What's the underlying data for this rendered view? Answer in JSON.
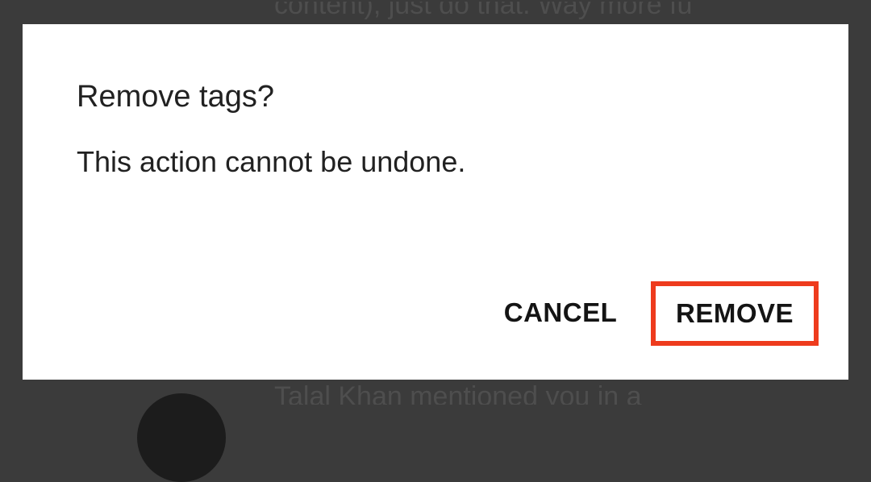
{
  "background": {
    "partial_text_top": "content), just do that. Way more fu",
    "partial_text_bottom": "Talal Khan mentioned you in a"
  },
  "dialog": {
    "title": "Remove tags?",
    "message": "This action cannot be undone.",
    "cancel_label": "CANCEL",
    "remove_label": "REMOVE"
  },
  "colors": {
    "scrim": "#3b3b3b",
    "dialog_bg": "#ffffff",
    "text": "#212121",
    "highlight_border": "#ee3b1d"
  }
}
